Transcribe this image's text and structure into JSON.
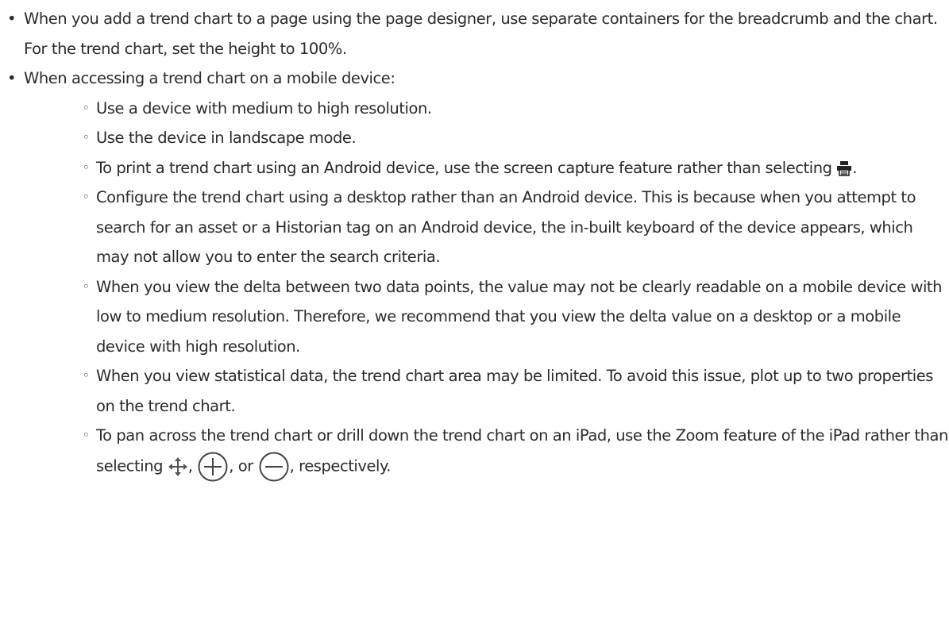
{
  "items": [
    {
      "text": "When you add a trend chart to a page using the page designer, use separate containers for the breadcrumb and the chart. For the trend chart, set the height to 100%."
    },
    {
      "text": "When accessing a trend chart on a mobile device:",
      "subitems": [
        {
          "text": "Use a device with medium to high resolution."
        },
        {
          "text": "Use the device in landscape mode."
        },
        {
          "text_before": "To print a trend chart using an Android device, use the screen capture feature rather than selecting ",
          "icon": "print-icon",
          "text_after": "."
        },
        {
          "text": "Configure the trend chart using a desktop rather than an Android device. This is because when you attempt to search for an asset or a Historian tag on an Android device, the in-built keyboard of the device appears, which may not allow you to enter the search criteria."
        },
        {
          "text": "When you view the delta between two data points, the value may not be clearly readable on a mobile device with low to medium resolution. Therefore, we recommend that you view the delta value on a desktop or a mobile device with high resolution."
        },
        {
          "text": "When you view statistical data, the trend chart area may be limited. To avoid this issue, plot up to two properties on the trend chart."
        },
        {
          "text_before": "To pan across the trend chart or drill down the trend chart on an iPad, use the Zoom feature of the iPad rather than selecting ",
          "icons": [
            "pan-arrows-icon",
            "zoom-in-circle-icon",
            "zoom-out-circle-icon"
          ],
          "sep1": ", ",
          "sep2": ", or ",
          "text_after": ", respectively."
        }
      ]
    }
  ]
}
